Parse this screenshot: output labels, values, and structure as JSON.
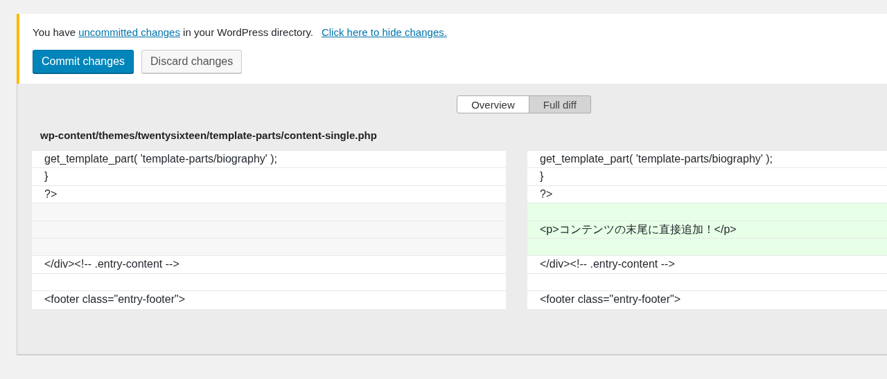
{
  "notice": {
    "message": [
      {
        "kind": "text",
        "text": "You have "
      },
      {
        "kind": "link",
        "text": "uncommitted changes"
      },
      {
        "kind": "text",
        "text": " in your WordPress directory."
      }
    ],
    "hide_link": "Click here to hide changes.",
    "buttons": [
      {
        "label": "Commit changes",
        "kind": "primary"
      },
      {
        "label": "Discard changes",
        "kind": "secondary"
      }
    ]
  },
  "tabs": [
    {
      "label": "Overview",
      "selected": false
    },
    {
      "label": "Full diff",
      "selected": true
    }
  ],
  "file_path": "wp-content/themes/twentysixteen/template-parts/content-single.php",
  "diff_rows": [
    {
      "left": {
        "kind": "context",
        "text": "get_template_part( 'template-parts/biography' );"
      },
      "right": {
        "kind": "context",
        "text": "get_template_part( 'template-parts/biography' );"
      }
    },
    {
      "left": {
        "kind": "context",
        "text": "}"
      },
      "right": {
        "kind": "context",
        "text": "}"
      }
    },
    {
      "left": {
        "kind": "context",
        "text": "?>"
      },
      "right": {
        "kind": "context",
        "text": "?>"
      }
    },
    {
      "left": {
        "kind": "empty"
      },
      "right": {
        "kind": "added"
      }
    },
    {
      "left": {
        "kind": "empty"
      },
      "right": {
        "kind": "added",
        "text": "<p>コンテンツの末尾に直接追加！</p>"
      }
    },
    {
      "left": {
        "kind": "empty"
      },
      "right": {
        "kind": "added"
      }
    },
    {
      "left": {
        "kind": "context",
        "text": "</div><!-- .entry-content -->"
      },
      "right": {
        "kind": "context",
        "text": "</div><!-- .entry-content -->"
      }
    },
    {
      "left": {
        "kind": "context"
      },
      "right": {
        "kind": "context"
      }
    },
    {
      "left": {
        "kind": "context",
        "text": "<footer class=\"entry-footer\">"
      },
      "right": {
        "kind": "context",
        "text": "<footer class=\"entry-footer\">"
      }
    }
  ]
}
